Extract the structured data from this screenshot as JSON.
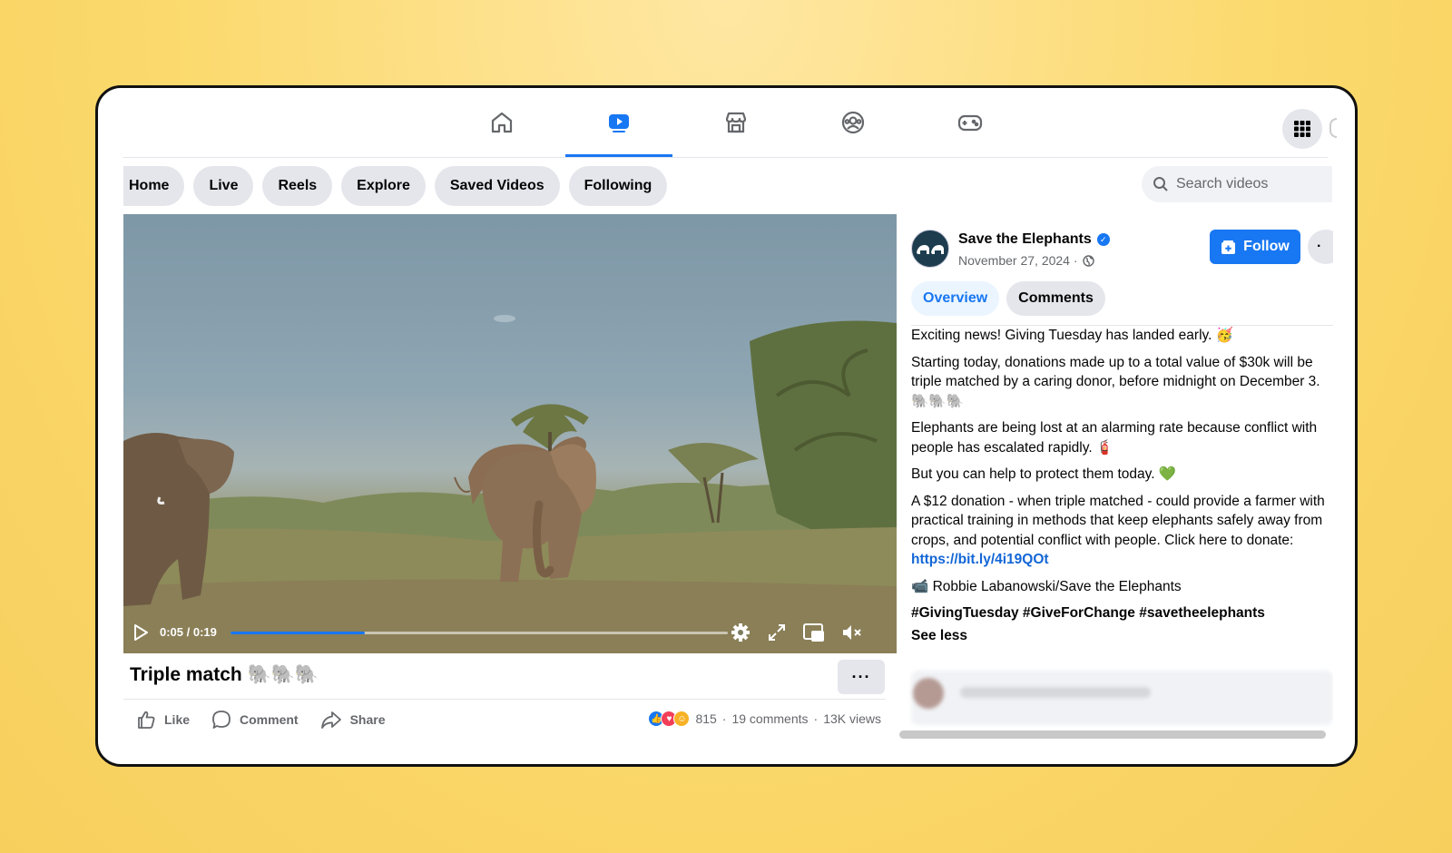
{
  "nav": {
    "tabs": [
      {
        "name": "home-tab",
        "icon": "home-icon",
        "active": false
      },
      {
        "name": "video-tab",
        "icon": "video-icon",
        "active": true
      },
      {
        "name": "marketplace-tab",
        "icon": "marketplace-icon",
        "active": false
      },
      {
        "name": "groups-tab",
        "icon": "groups-icon",
        "active": false
      },
      {
        "name": "gaming-tab",
        "icon": "gaming-icon",
        "active": false
      }
    ],
    "menu_icon": "grid-menu-icon",
    "accent_color": "#1877f2"
  },
  "chips": [
    "Home",
    "Live",
    "Reels",
    "Explore",
    "Saved Videos",
    "Following"
  ],
  "search": {
    "placeholder": "Search videos"
  },
  "video": {
    "time": "0:05 / 0:19",
    "progress_fraction": 0.27,
    "title": "Triple match 🐘🐘🐘",
    "more_label": "···"
  },
  "actions": {
    "like": "Like",
    "comment": "Comment",
    "share": "Share"
  },
  "stats": {
    "reactions": "815",
    "comments": "19 comments",
    "views": "13K views"
  },
  "post": {
    "page_name": "Save the Elephants",
    "date": "November 27, 2024 ·",
    "follow_label": "Follow",
    "tabs": {
      "overview": "Overview",
      "comments": "Comments"
    },
    "p1": "Exciting news! Giving Tuesday has landed early. 🥳",
    "p2": "Starting today, donations made up to a total value of $30k will be triple matched by a caring donor, before midnight on December 3. 🐘🐘🐘",
    "p3": "Elephants are being lost at an alarming rate because conflict with people has escalated rapidly. 🧯",
    "p4": "But you can help to protect them today. 💚",
    "p5": "A $12 donation - when triple matched - could provide a farmer with practical training in methods that keep elephants safely away from crops, and potential conflict with people. Click here to donate: ",
    "link": "https://bit.ly/4i19QOt",
    "p6": "📹 Robbie Labanowski/Save the Elephants",
    "hashtags": "#GivingTuesday #GiveForChange #savetheelephants",
    "see_less": "See less"
  }
}
